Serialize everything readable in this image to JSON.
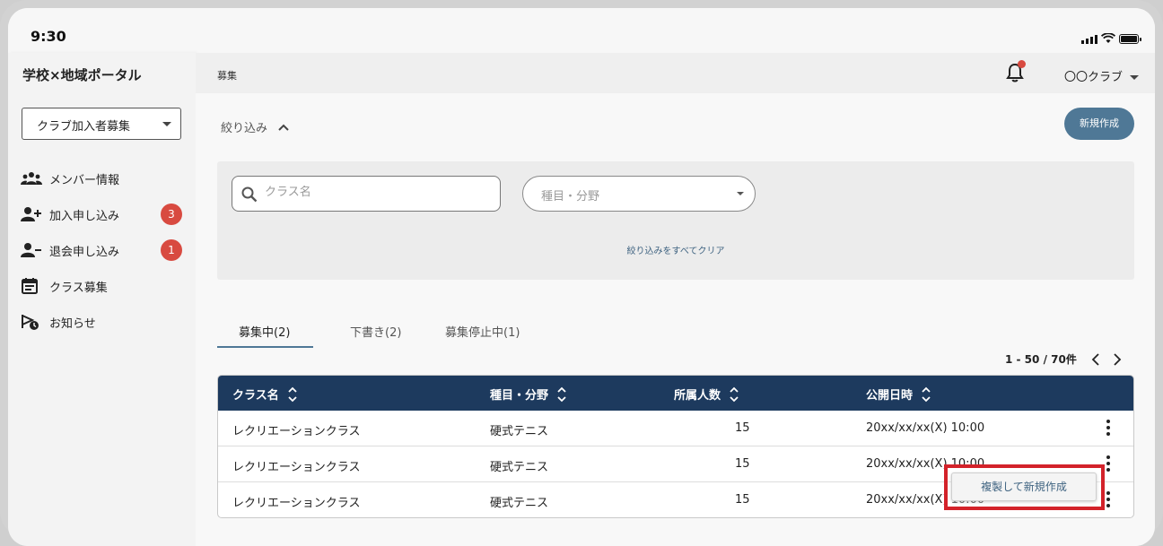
{
  "status": {
    "time": "9:30"
  },
  "app": {
    "title": "学校×地域ポータル"
  },
  "sidebar": {
    "select_value": "クラブ加入者募集",
    "items": [
      {
        "label": "メンバー情報",
        "icon": "members-icon"
      },
      {
        "label": "加入申し込み",
        "icon": "add-person-icon",
        "badge": "3"
      },
      {
        "label": "退会申し込み",
        "icon": "remove-person-icon",
        "badge": "1"
      },
      {
        "label": "クラス募集",
        "icon": "calendar-icon"
      },
      {
        "label": "お知らせ",
        "icon": "announcement-icon"
      }
    ]
  },
  "header": {
    "breadcrumb": "募集",
    "user": "〇〇クラブ"
  },
  "filter": {
    "toggle_label": "絞り込み",
    "search_placeholder": "クラス名",
    "category_placeholder": "種目・分野",
    "clear_label": "絞り込みをすべてクリア"
  },
  "toolbar": {
    "new_label": "新規作成"
  },
  "tabs": [
    {
      "label": "募集中(2)",
      "active": true
    },
    {
      "label": "下書き(2)",
      "active": false
    },
    {
      "label": "募集停止中(1)",
      "active": false
    }
  ],
  "pager": {
    "label": "1 - 50 / 70件"
  },
  "table": {
    "columns": [
      "クラス名",
      "種目・分野",
      "所属人数",
      "公開日時"
    ],
    "rows": [
      {
        "name": "レクリエーションクラス",
        "category": "硬式テニス",
        "members": "15",
        "date": "20xx/xx/xx(X) 10:00"
      },
      {
        "name": "レクリエーションクラス",
        "category": "硬式テニス",
        "members": "15",
        "date": "20xx/xx/xx(X) 10:00"
      },
      {
        "name": "レクリエーションクラス",
        "category": "硬式テニス",
        "members": "15",
        "date": "20xx/xx/xx(X) 10:00"
      }
    ]
  },
  "popup": {
    "label": "複製して新規作成"
  },
  "colors": {
    "header": "#1d3a5e",
    "accent": "#4f7896",
    "badge": "#d84a40",
    "highlight": "#d3222a"
  }
}
